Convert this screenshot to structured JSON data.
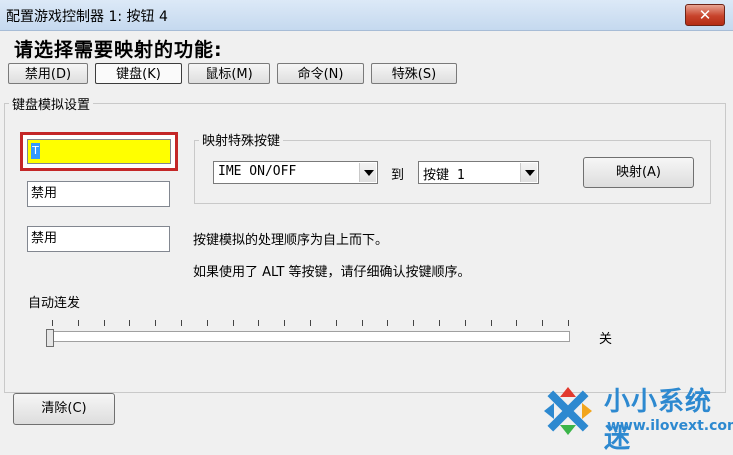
{
  "window": {
    "title": "配置游戏控制器 1: 按钮 4",
    "close_label": "✕"
  },
  "heading": "请选择需要映射的功能:",
  "tabs": [
    {
      "label": "禁用(D)"
    },
    {
      "label": "键盘(K)"
    },
    {
      "label": "鼠标(M)"
    },
    {
      "label": "命令(N)"
    },
    {
      "label": "特殊(S)"
    }
  ],
  "keyboard_group": {
    "label": "键盘模拟设置",
    "field1_value": "T",
    "field2_value": "禁用",
    "field3_value": "禁用"
  },
  "special_group": {
    "label": "映射特殊按键",
    "combo1_value": "IME ON/OFF",
    "to_label": "到",
    "combo2_value": "按键 1",
    "map_button": "映射(A)"
  },
  "info": {
    "line1": "按键模拟的处理顺序为自上而下。",
    "line2": "如果使用了 ALT 等按键，请仔细确认按键顺序。"
  },
  "autofire": {
    "label": "自动连发",
    "value_label": "关",
    "level": 0
  },
  "clear_button": "清除(C)",
  "watermark": {
    "name": "小小系统迷",
    "url": "www.ilovext.com"
  },
  "colors": {
    "highlight_border": "#c42727",
    "field_fill": "#ffff00",
    "watermark": "#2d89d0"
  }
}
